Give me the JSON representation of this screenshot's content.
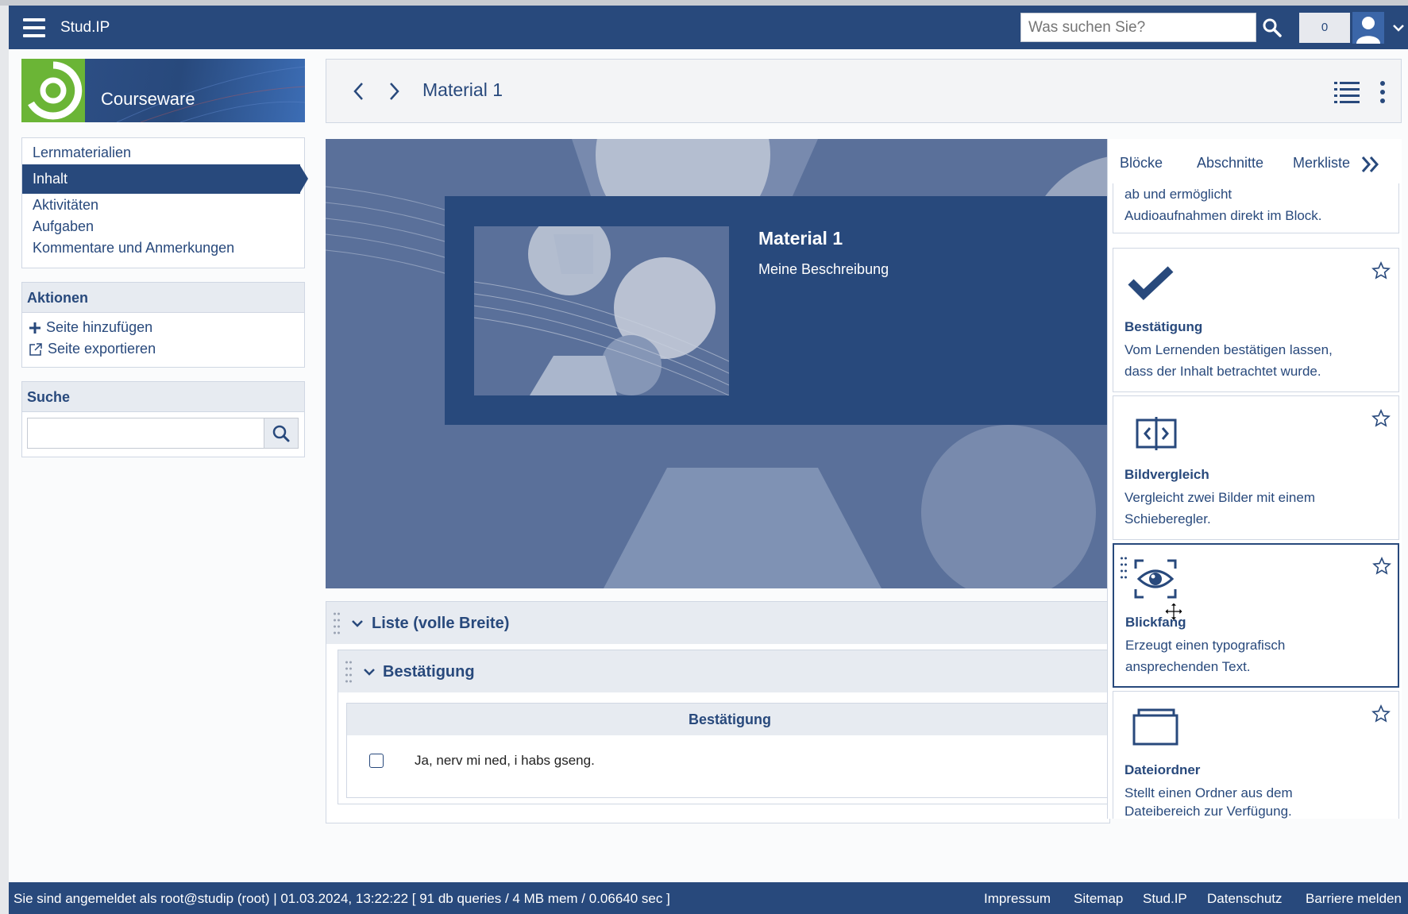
{
  "header": {
    "brand": "Stud.IP",
    "search_placeholder": "Was suchen Sie?",
    "notification_count": "0"
  },
  "sidebar": {
    "logo_title": "Courseware",
    "nav": [
      "Lernmaterialien",
      "Inhalt",
      "Aktivitäten",
      "Aufgaben",
      "Kommentare und Anmerkungen"
    ],
    "active_nav": "Inhalt",
    "actions": {
      "title": "Aktionen",
      "items": [
        "Seite hinzufügen",
        "Seite exportieren"
      ]
    },
    "search": {
      "title": "Suche",
      "value": ""
    }
  },
  "content": {
    "page_title": "Material 1",
    "hero": {
      "title": "Material 1",
      "description": "Meine Beschreibung"
    },
    "sections": {
      "outer_label": "Liste (volle Breite)",
      "inner_label": "Bestätigung",
      "confirm_header": "Bestätigung",
      "confirm_text": "Ja, nerv mi ned, i habs gseng.",
      "checked": false
    }
  },
  "panel": {
    "tabs": [
      "Blöcke",
      "Abschnitte",
      "Merkliste"
    ],
    "active_tab": "Blöcke",
    "partial_desc_1": "ab und ermöglicht",
    "partial_desc_2": "Audioaufnahmen direkt im Block.",
    "blocks": [
      {
        "title": "Bestätigung",
        "desc1": "Vom Lernenden bestätigen lassen,",
        "desc2": "dass der Inhalt betrachtet wurde.",
        "icon": "checkmark-icon"
      },
      {
        "title": "Bildvergleich",
        "desc1": "Vergleicht zwei Bilder mit einem",
        "desc2": "Schieberegler.",
        "icon": "image-compare-icon"
      },
      {
        "title": "Blickfang",
        "desc1": "Erzeugt einen typografisch",
        "desc2": "ansprechenden Text.",
        "icon": "eye-focus-icon"
      },
      {
        "title": "Dateiordner",
        "desc1": "Stellt einen Ordner aus dem",
        "desc2": "Dateibereich zur Verfügung.",
        "icon": "folder-icon"
      }
    ]
  },
  "footer": {
    "status": "Sie sind angemeldet als root@studip (root) | 01.03.2024, 13:22:22 [ 91 db queries / 4 MB mem / 0.06640 sec ]",
    "links": [
      "Impressum",
      "Sitemap",
      "Stud.IP",
      "Datenschutz",
      "Barriere melden"
    ]
  },
  "colors": {
    "primary": "#28497c",
    "accent_green": "#6bb536",
    "hero_bg": "#5a709a",
    "panel_bg": "#e7ebf1"
  }
}
